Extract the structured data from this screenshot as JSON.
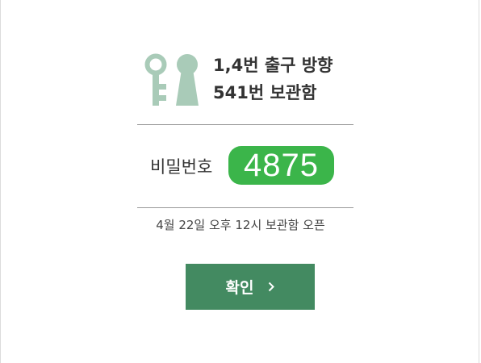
{
  "locker": {
    "exit_direction": "1,4번 출구 방향",
    "locker_number": "541번 보관함"
  },
  "password": {
    "label": "비밀번호",
    "code": "4875"
  },
  "open_time": "4월 22일 오후 12시 보관함 오픈",
  "confirm": {
    "label": "확인"
  },
  "colors": {
    "icon": "#a9cbb8",
    "code_badge": "#3bb54a",
    "confirm_button": "#438a61",
    "divider": "#9a9a9a"
  },
  "icons": {
    "key": "key-icon",
    "keyhole": "keyhole-icon",
    "chevron": "chevron-right-icon"
  }
}
